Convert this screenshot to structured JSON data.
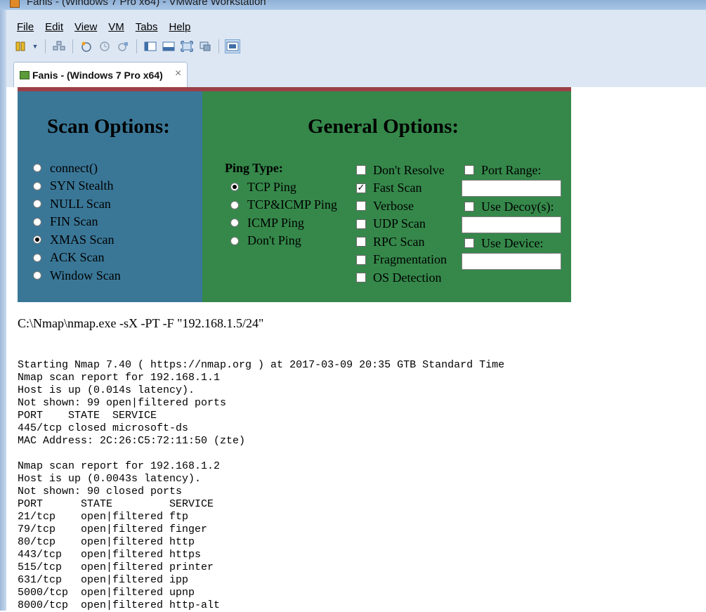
{
  "window": {
    "title": "Fanis - (Windows 7 Pro x64) - VMware Workstation"
  },
  "menu": [
    {
      "label": "File",
      "mnemonic_index": 0
    },
    {
      "label": "Edit",
      "mnemonic_index": 0
    },
    {
      "label": "View",
      "mnemonic_index": 0
    },
    {
      "label": "VM",
      "mnemonic_index": 0
    },
    {
      "label": "Tabs",
      "mnemonic_index": 0
    },
    {
      "label": "Help",
      "mnemonic_index": 0
    }
  ],
  "tab": {
    "label": "Fanis - (Windows 7 Pro x64)",
    "close": "×"
  },
  "scan_options": {
    "title": "Scan Options:",
    "items": [
      "connect()",
      "SYN Stealth",
      "NULL Scan",
      "FIN Scan",
      "XMAS Scan",
      "ACK Scan",
      "Window Scan"
    ],
    "selected": "XMAS Scan"
  },
  "general_options": {
    "title": "General Options:",
    "ping_label": "Ping Type:",
    "ping_items": [
      "TCP Ping",
      "TCP&ICMP Ping",
      "ICMP Ping",
      "Don't Ping"
    ],
    "ping_selected": "TCP Ping",
    "checks": [
      {
        "label": "Don't Resolve",
        "checked": false
      },
      {
        "label": "Fast Scan",
        "checked": true
      },
      {
        "label": "Verbose",
        "checked": false
      },
      {
        "label": "UDP Scan",
        "checked": false
      },
      {
        "label": "RPC Scan",
        "checked": false
      },
      {
        "label": "Fragmentation",
        "checked": false
      },
      {
        "label": "OS Detection",
        "checked": false
      }
    ],
    "right_checks": [
      {
        "label": "Port Range:",
        "checked": false,
        "value": ""
      },
      {
        "label": "Use Decoy(s):",
        "checked": false,
        "value": ""
      },
      {
        "label": "Use Device:",
        "checked": false,
        "value": ""
      }
    ],
    "check_mark": "✓"
  },
  "command": "C:\\Nmap\\nmap.exe -sX -PT -F \"192.168.1.5/24\"",
  "output_lines": [
    "Starting Nmap 7.40 ( https://nmap.org ) at 2017-03-09 20:35 GTB Standard Time",
    "Nmap scan report for 192.168.1.1",
    "Host is up (0.014s latency).",
    "Not shown: 99 open|filtered ports",
    "PORT    STATE  SERVICE",
    "445/tcp closed microsoft-ds",
    "MAC Address: 2C:26:C5:72:11:50 (zte)",
    "",
    "Nmap scan report for 192.168.1.2",
    "Host is up (0.0043s latency).",
    "Not shown: 90 closed ports",
    "PORT      STATE         SERVICE",
    "21/tcp    open|filtered ftp",
    "79/tcp    open|filtered finger",
    "80/tcp    open|filtered http",
    "443/tcp   open|filtered https",
    "515/tcp   open|filtered printer",
    "631/tcp   open|filtered ipp",
    "5000/tcp  open|filtered upnp",
    "8000/tcp  open|filtered http-alt"
  ]
}
